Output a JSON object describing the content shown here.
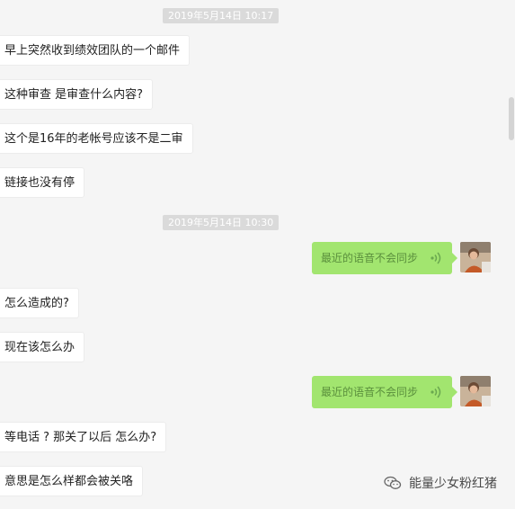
{
  "chat": {
    "timestamps": [
      "2019年5月14日 10:17",
      "2019年5月14日 10:30"
    ],
    "incoming": [
      "早上突然收到绩效团队的一个邮件",
      "这种审查 是审查什么内容?",
      "这个是16年的老帐号应该不是二审",
      "链接也没有停",
      "怎么造成的?",
      "现在该怎么办",
      "等电话 ?   那关了以后 怎么办?",
      "意思是怎么样都会被关咯"
    ],
    "outgoing": [
      "最近的语音不会同步",
      "最近的语音不会同步"
    ],
    "icons": {
      "voice": "voice-wave-icon",
      "avatar": "user-avatar-photo",
      "watermark": "wechat-logo-icon"
    }
  },
  "watermark": {
    "text": "能量少女粉红猪"
  }
}
